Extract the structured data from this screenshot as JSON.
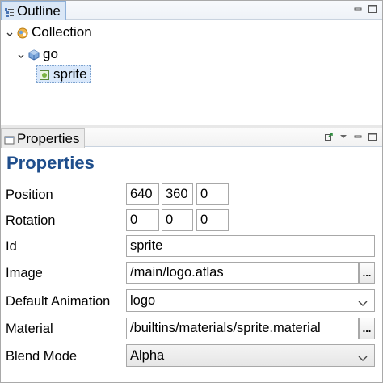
{
  "outline": {
    "tab_label": "Outline",
    "tree": {
      "root": {
        "label": "Collection",
        "expanded": true
      },
      "child": {
        "label": "go",
        "expanded": true
      },
      "leaf": {
        "label": "sprite",
        "selected": true
      }
    }
  },
  "properties_view": {
    "tab_label": "Properties"
  },
  "properties": {
    "title": "Properties",
    "position": {
      "label": "Position",
      "x": "640",
      "y": "360",
      "z": "0"
    },
    "rotation": {
      "label": "Rotation",
      "x": "0",
      "y": "0",
      "z": "0"
    },
    "id": {
      "label": "Id",
      "value": "sprite"
    },
    "image": {
      "label": "Image",
      "value": "/main/logo.atlas",
      "browse_label": "..."
    },
    "default_animation": {
      "label": "Default Animation",
      "value": "logo"
    },
    "material": {
      "label": "Material",
      "value": "/builtins/materials/sprite.material",
      "browse_label": "..."
    },
    "blend_mode": {
      "label": "Blend Mode",
      "value": "Alpha"
    }
  },
  "colors": {
    "title_blue": "#1f4e8c",
    "selection_bg": "#d9e8fb",
    "active_tab_bg": "#dae7f6"
  },
  "icons": [
    "outline-view-icon",
    "properties-view-icon",
    "collection-icon",
    "game-object-icon",
    "sprite-icon",
    "minimize-icon",
    "maximize-icon",
    "view-menu-icon",
    "pin-icon"
  ]
}
